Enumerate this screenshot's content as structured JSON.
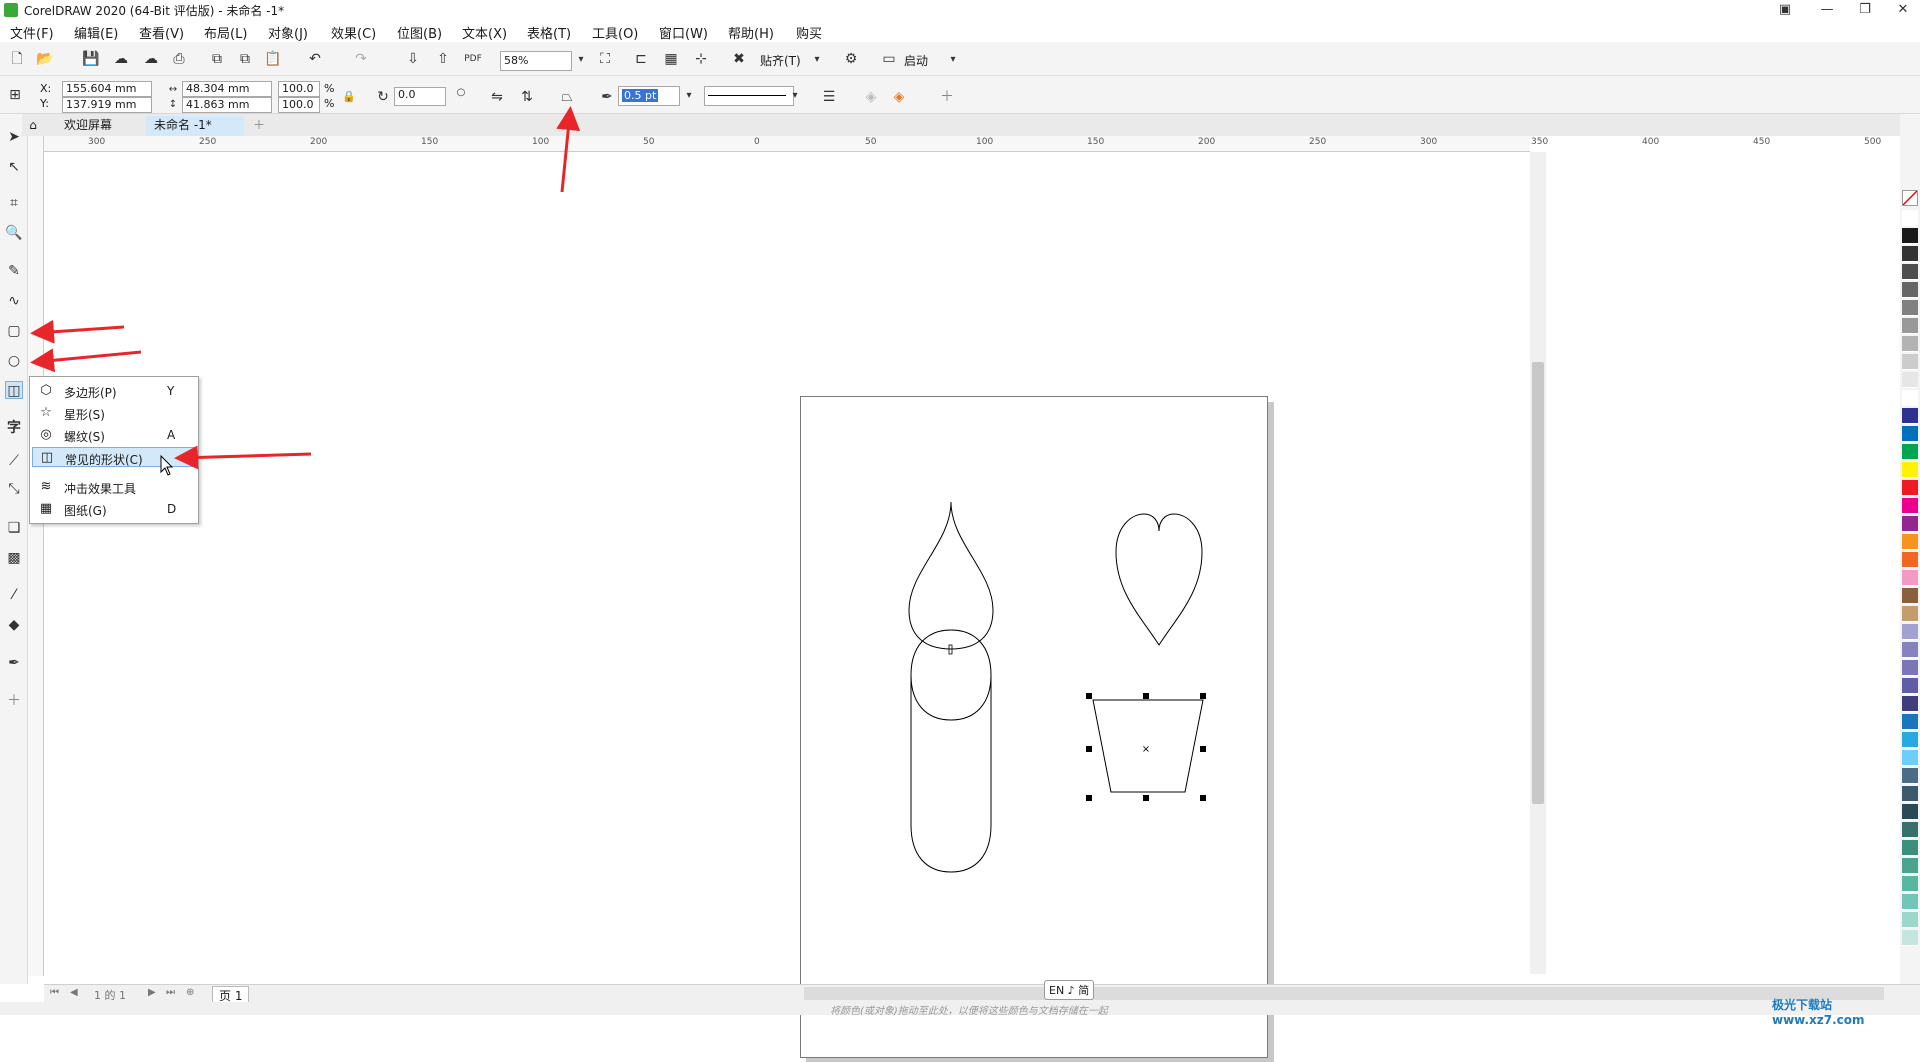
{
  "window": {
    "title": "CorelDRAW 2020 (64-Bit 评估版) - 未命名 -1*"
  },
  "menu": [
    "文件(F)",
    "编辑(E)",
    "查看(V)",
    "布局(L)",
    "对象(J)",
    "效果(C)",
    "位图(B)",
    "文本(X)",
    "表格(T)",
    "工具(O)",
    "窗口(W)",
    "帮助(H)",
    "购买"
  ],
  "toolbar": {
    "zoom": "58%",
    "snap_label": "贴齐(T)",
    "launch_label": "启动"
  },
  "props": {
    "x_label": "X:",
    "y_label": "Y:",
    "x": "155.604 mm",
    "y": "137.919 mm",
    "w": "48.304 mm",
    "h": "41.863 mm",
    "sx": "100.0",
    "sy": "100.0",
    "pct": "%",
    "angle": "0.0",
    "outline": "0.5 pt"
  },
  "tabs": [
    "欢迎屏幕",
    "未命名 -1*"
  ],
  "ruler_h": [
    "300",
    "250",
    "200",
    "150",
    "100",
    "50",
    "0",
    "50",
    "100",
    "150",
    "200",
    "250",
    "300",
    "350",
    "400",
    "450",
    "500"
  ],
  "flyout": [
    {
      "label": "多边形(P)",
      "key": "Y",
      "icon": "polygon-icon",
      "glyph": "⬡"
    },
    {
      "label": "星形(S)",
      "key": "",
      "icon": "star-icon",
      "glyph": "☆"
    },
    {
      "label": "螺纹(S)",
      "key": "A",
      "icon": "spiral-icon",
      "glyph": "◎"
    },
    {
      "label": "常见的形状(C)",
      "key": "",
      "icon": "common-shapes-icon",
      "glyph": "◫"
    },
    {
      "label": "冲击效果工具",
      "key": "",
      "icon": "impact-tool-icon",
      "glyph": "≋"
    },
    {
      "label": "图纸(G)",
      "key": "D",
      "icon": "graph-paper-icon",
      "glyph": "▦"
    }
  ],
  "page_nav": {
    "text": "1 的 1",
    "page_tab": "页 1"
  },
  "ime": "EN ♪ 简",
  "status_hint": "将颜色(或对象)拖动至此处，以便将这些颜色与文档存储在一起",
  "watermark": "极光下载站 www.xz7.com",
  "palette": [
    "#ffffff",
    "#1a1a1a",
    "#333333",
    "#4d4d4d",
    "#666666",
    "#808080",
    "#999999",
    "#b3b3b3",
    "#cccccc",
    "#e6e6e6",
    "#ffffff",
    "#2e3192",
    "#0072bc",
    "#00a651",
    "#fff200",
    "#ed1c24",
    "#ec008c",
    "#92278f",
    "#f7941d",
    "#f26522",
    "#f49ac2",
    "#8b5e3c",
    "#c69c6d",
    "#a3a1d1",
    "#8781bd",
    "#7b76b6",
    "#605ca8",
    "#3f3d7a",
    "#1b75bc",
    "#27aae1",
    "#6dcff6",
    "#4a6c85",
    "#3b5a6b",
    "#2a4a57",
    "#36716b",
    "#3c8f7d",
    "#4aa58f",
    "#56b8a0",
    "#73c6b6",
    "#9dd6ca",
    "#c5e6df"
  ]
}
